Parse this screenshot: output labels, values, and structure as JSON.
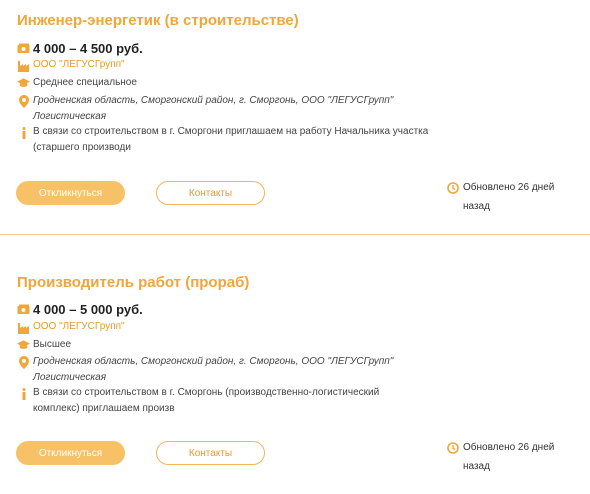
{
  "vacancies": [
    {
      "title": "Инженер-энергетик (в строительстве)",
      "salary": "4 000 – 4 500 руб.",
      "company": "ООО \"ЛЕГУСГрупп\"",
      "education": "Среднее специальное",
      "location_line1": "Гродненская область, Сморгонский район, г. Сморгонь, ООО \"ЛЕГУСГрупп\"",
      "location_line2": "Логистическая",
      "description_line1": "В связи со строительством в г. Сморгони приглашаем на работу Начальника участка",
      "description_line2": "(старшего производи",
      "apply_label": "Откликнуться",
      "contacts_label": "Контакты",
      "updated_line1": "Обновлено 26 дней",
      "updated_line2": "назад"
    },
    {
      "title": "Производитель работ (прораб)",
      "salary": "4 000 – 5 000 руб.",
      "company": "ООО \"ЛЕГУСГрупп\"",
      "education": "Высшее",
      "location_line1": "Гродненская область, Сморгонский район, г. Сморгонь, ООО \"ЛЕГУСГрупп\"",
      "location_line2": "Логистическая",
      "description_line1": "В связи со строительством в г. Сморгонь (производственно-логистический",
      "description_line2": "комплекс) приглашаем произв",
      "apply_label": "Откликнуться",
      "contacts_label": "Контакты",
      "updated_line1": "Обновлено 26 дней",
      "updated_line2": "назад"
    }
  ],
  "colors": {
    "accent": "#f0a63a",
    "button_fill": "#f7c267",
    "divider": "#f4c988"
  },
  "icons": [
    "money-icon",
    "company-icon",
    "education-icon",
    "location-icon",
    "info-icon",
    "clock-icon"
  ]
}
